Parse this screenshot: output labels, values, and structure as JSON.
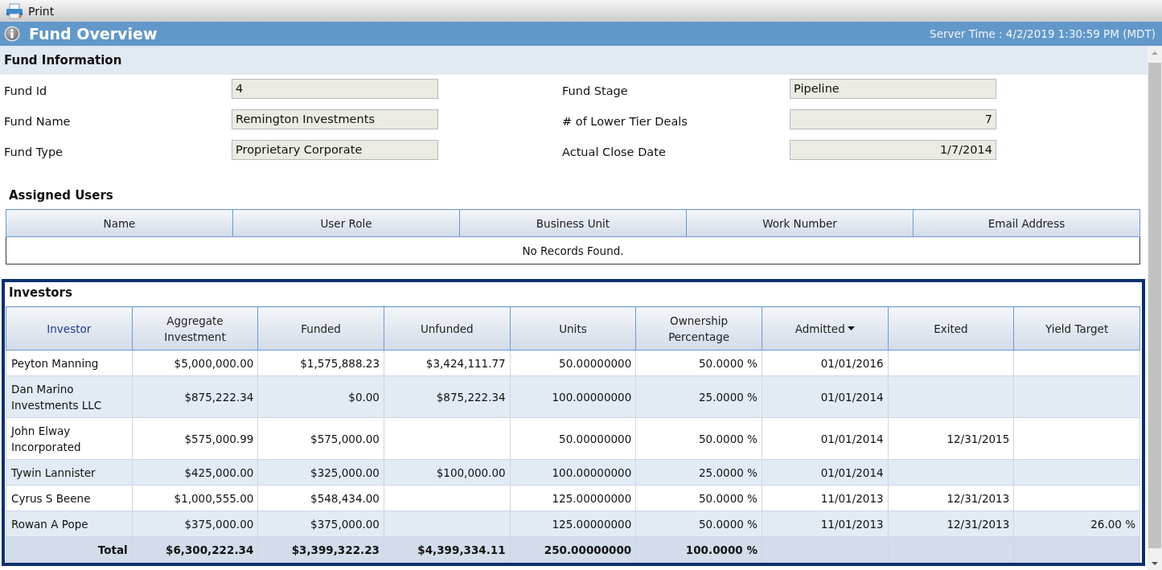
{
  "toolbar": {
    "print": "Print"
  },
  "header": {
    "title": "Fund Overview",
    "server_time": "Server Time : 4/2/2019 1:30:59 PM (MDT)"
  },
  "fund_information": {
    "title": "Fund Information",
    "fields": [
      {
        "label": "Fund Id",
        "value": "4",
        "kind": "text"
      },
      {
        "label": "Fund Stage",
        "value": "Pipeline",
        "kind": "text"
      },
      {
        "label": "Fund Name",
        "value": "Remington Investments",
        "kind": "text"
      },
      {
        "label": "# of Lower Tier Deals",
        "value": "7",
        "kind": "number"
      },
      {
        "label": "Fund Type",
        "value": "Proprietary Corporate",
        "kind": "text"
      },
      {
        "label": "Actual Close Date",
        "value": "1/7/2014",
        "kind": "date"
      }
    ]
  },
  "assigned_users": {
    "title": "Assigned Users",
    "columns": [
      "Name",
      "User Role",
      "Business Unit",
      "Work Number",
      "Email Address"
    ],
    "empty_message": "No Records Found."
  },
  "investors": {
    "title": "Investors",
    "columns": [
      {
        "label": "Investor",
        "link": true,
        "sorted": false
      },
      {
        "label": "Aggregate Investment",
        "link": false,
        "sorted": false
      },
      {
        "label": "Funded",
        "link": false,
        "sorted": false
      },
      {
        "label": "Unfunded",
        "link": false,
        "sorted": false
      },
      {
        "label": "Units",
        "link": false,
        "sorted": false
      },
      {
        "label": "Ownership Percentage",
        "link": false,
        "sorted": false
      },
      {
        "label": "Admitted",
        "link": false,
        "sorted": true
      },
      {
        "label": "Exited",
        "link": false,
        "sorted": false
      },
      {
        "label": "Yield Target",
        "link": false,
        "sorted": false
      }
    ],
    "rows": [
      {
        "investor": "Peyton Manning",
        "aggregate_investment": "$5,000,000.00",
        "funded": "$1,575,888.23",
        "unfunded": "$3,424,111.77",
        "units": "50.00000000",
        "ownership_percentage": "50.0000 %",
        "admitted": "01/01/2016"
      },
      {
        "investor": "Dan Marino Investments LLC",
        "aggregate_investment": "$875,222.34",
        "funded": "$0.00",
        "unfunded": "$875,222.34",
        "units": "100.00000000",
        "ownership_percentage": "25.0000 %",
        "admitted": "01/01/2014"
      },
      {
        "investor": "John Elway Incorporated",
        "aggregate_investment": "$575,000.99",
        "funded": "$575,000.00",
        "units": "50.00000000",
        "ownership_percentage": "50.0000 %",
        "admitted": "01/01/2014",
        "exited": "12/31/2015"
      },
      {
        "investor": "Tywin Lannister",
        "aggregate_investment": "$425,000.00",
        "funded": "$325,000.00",
        "unfunded": "$100,000.00",
        "units": "100.00000000",
        "ownership_percentage": "25.0000 %",
        "admitted": "01/01/2014"
      },
      {
        "investor": "Cyrus S Beene",
        "aggregate_investment": "$1,000,555.00",
        "funded": "$548,434.00",
        "units": "125.00000000",
        "ownership_percentage": "50.0000 %",
        "admitted": "11/01/2013",
        "exited": "12/31/2013"
      },
      {
        "investor": "Rowan A Pope",
        "aggregate_investment": "$375,000.00",
        "funded": "$375,000.00",
        "units": "125.00000000",
        "ownership_percentage": "50.0000 %",
        "admitted": "11/01/2013",
        "exited": "12/31/2013",
        "yield_target": "26.00 %"
      }
    ],
    "total": {
      "label": "Total",
      "aggregate_investment": "$6,300,222.34",
      "funded": "$3,399,322.23",
      "unfunded": "$4,399,334.11",
      "units": "250.00000000",
      "ownership_percentage": "100.0000 %"
    }
  }
}
